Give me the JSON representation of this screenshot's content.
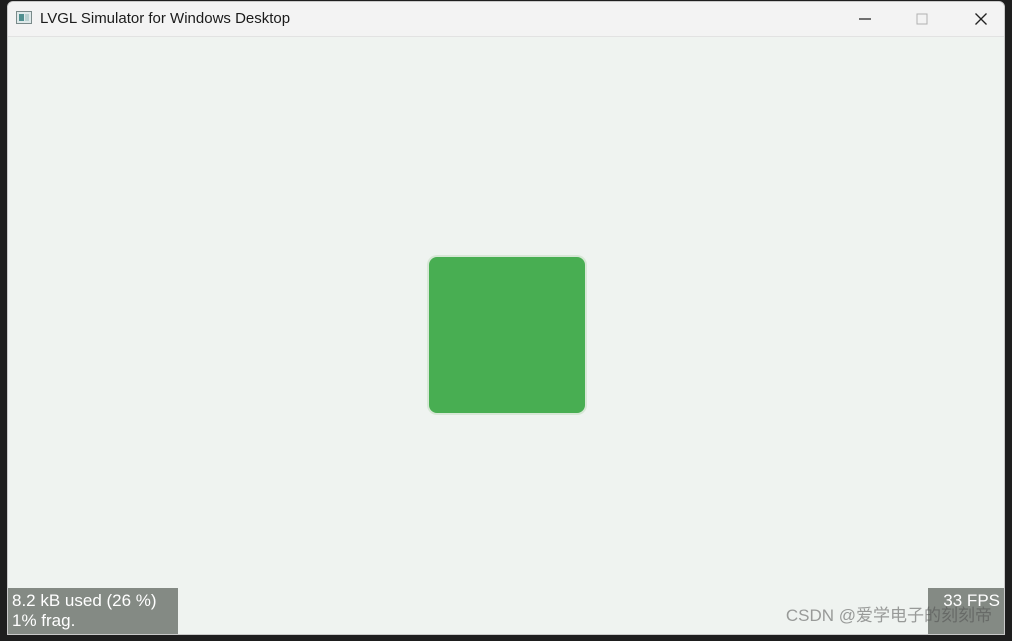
{
  "window": {
    "title": "LVGL Simulator for Windows Desktop",
    "icon": "app-window-icon",
    "controls": {
      "minimize_icon": "minimize-icon",
      "maximize_icon": "maximize-icon",
      "close_icon": "close-icon"
    }
  },
  "canvas": {
    "background": "#eff3f0",
    "object_color": "#48ae52"
  },
  "perf_monitor": {
    "memory_used": "8.2 kB used (26 %)",
    "fragmentation": "1% frag.",
    "fps": "33 FPS"
  },
  "watermark": "CSDN @爱学电子的刻刻帝"
}
